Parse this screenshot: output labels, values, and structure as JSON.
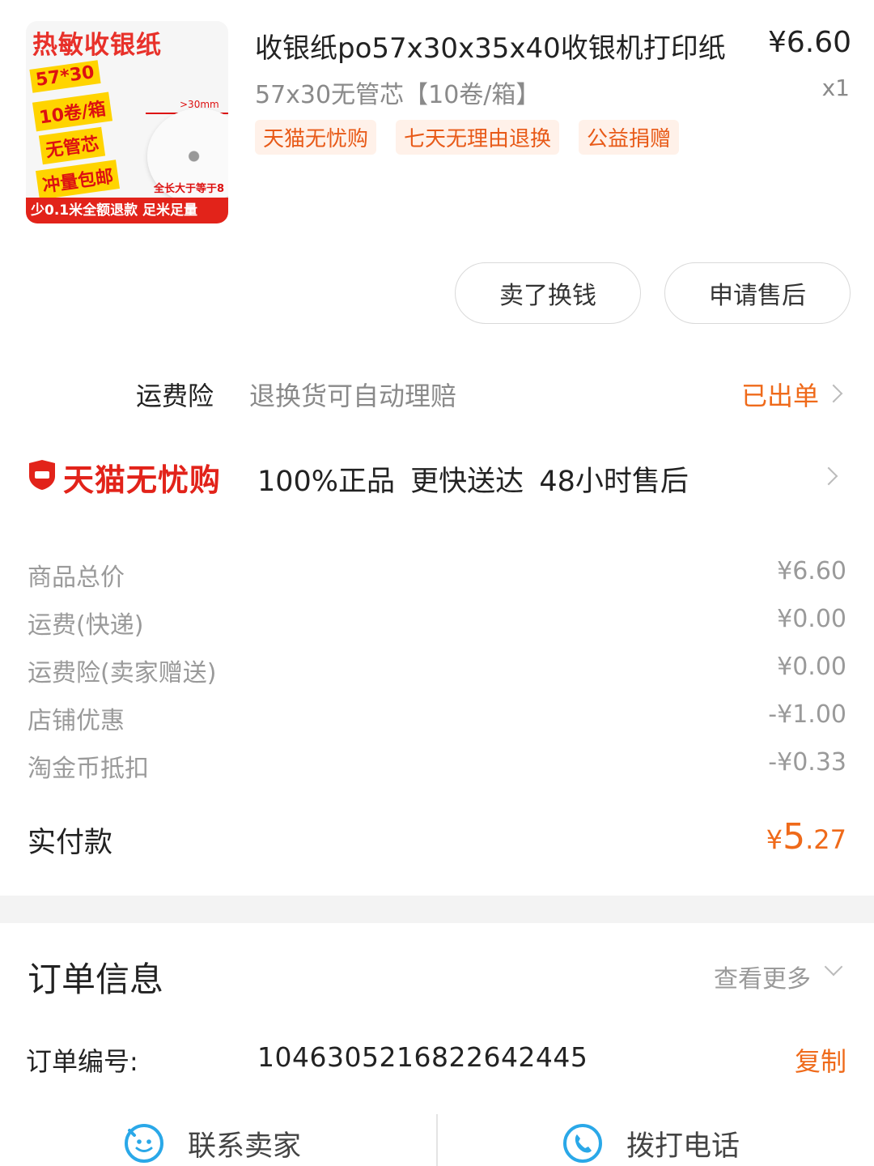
{
  "product": {
    "thumbnail": {
      "title": "热敏收银纸",
      "tag1": "57*30",
      "tag2": "10卷/箱",
      "tag3": "无管芯",
      "tag4": "冲量包邮",
      "dimension": ">30mm",
      "length_note": "全长大于等于8米",
      "bottom_banner": "少0.1米全额退款  足米足量"
    },
    "title": "收银纸po57x30x35x40收银机打印纸",
    "price": "¥6.60",
    "spec": "57x30无管芯【10卷/箱】",
    "quantity": "x1",
    "tags": [
      "天猫无忧购",
      "七天无理由退换",
      "公益捐赠"
    ]
  },
  "actions": {
    "sell_label": "卖了换钱",
    "aftersale_label": "申请售后"
  },
  "insurance": {
    "label": "运费险",
    "description": "退换货可自动理赔",
    "status": "已出单"
  },
  "tmall_guarantee": {
    "name": "天猫无忧购",
    "features": "100%正品  更快送达  48小时售后"
  },
  "fees": [
    {
      "label": "商品总价",
      "value": "¥6.60"
    },
    {
      "label": "运费(快递)",
      "value": "¥0.00"
    },
    {
      "label": "运费险(卖家赠送)",
      "value": "¥0.00"
    },
    {
      "label": "店铺优惠",
      "value": "-¥1.00"
    },
    {
      "label": "淘金币抵扣",
      "value": "-¥0.33"
    }
  ],
  "paid": {
    "label": "实付款",
    "currency": "¥",
    "integer": "5",
    "decimal": ".27"
  },
  "order_info": {
    "title": "订单信息",
    "more_label": "查看更多",
    "number_label": "订单编号:",
    "number": "1046305216822642445",
    "copy_label": "复制"
  },
  "bottom_bar": {
    "contact_label": "联系卖家",
    "call_label": "拨打电话"
  },
  "colors": {
    "accent": "#ef6a1a",
    "tmall_red": "#e2231a",
    "tag_bg": "#fff1e9",
    "icon_blue": "#2aa8e8"
  }
}
